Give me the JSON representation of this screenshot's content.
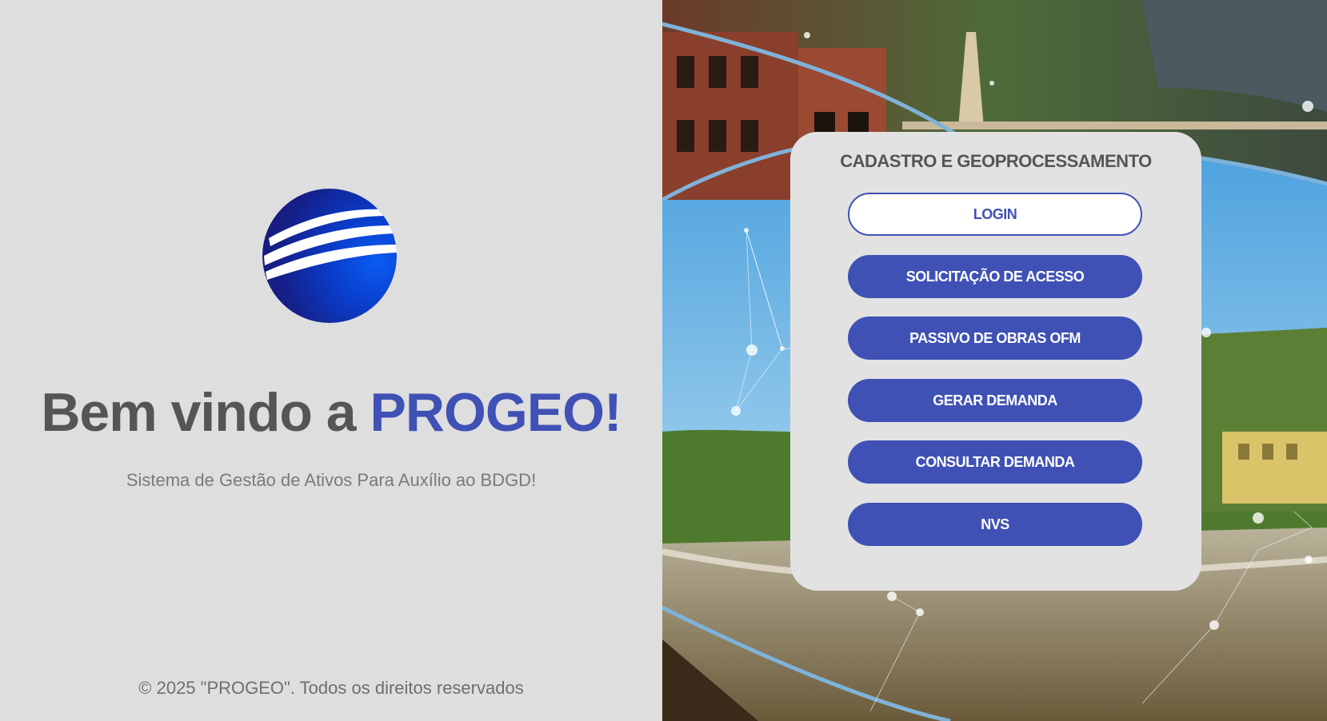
{
  "welcome": {
    "prefix": "Bem vindo a ",
    "brand": "PROGEO!",
    "subtitle": "Sistema de Gestão de Ativos Para Auxílio ao BDGD!"
  },
  "footer": {
    "copyright": "© 2025 \"PROGEO\". Todos os direitos reservados"
  },
  "card": {
    "title": "CADASTRO E GEOPROCESSAMENTO",
    "buttons": [
      {
        "label": "LOGIN",
        "style": "outline"
      },
      {
        "label": "SOLICITAÇÃO DE ACESSO",
        "style": "filled"
      },
      {
        "label": "PASSIVO DE OBRAS OFM",
        "style": "filled"
      },
      {
        "label": "GERAR DEMANDA",
        "style": "filled"
      },
      {
        "label": "CONSULTAR DEMANDA",
        "style": "filled"
      },
      {
        "label": "NVS",
        "style": "filled"
      }
    ]
  },
  "colors": {
    "brand": "#3f51b5",
    "left_background": "#dedede",
    "card_background": "#e2e2e2",
    "text_dark": "#555555"
  },
  "icons": {
    "logo": "globe-stripes-logo"
  }
}
